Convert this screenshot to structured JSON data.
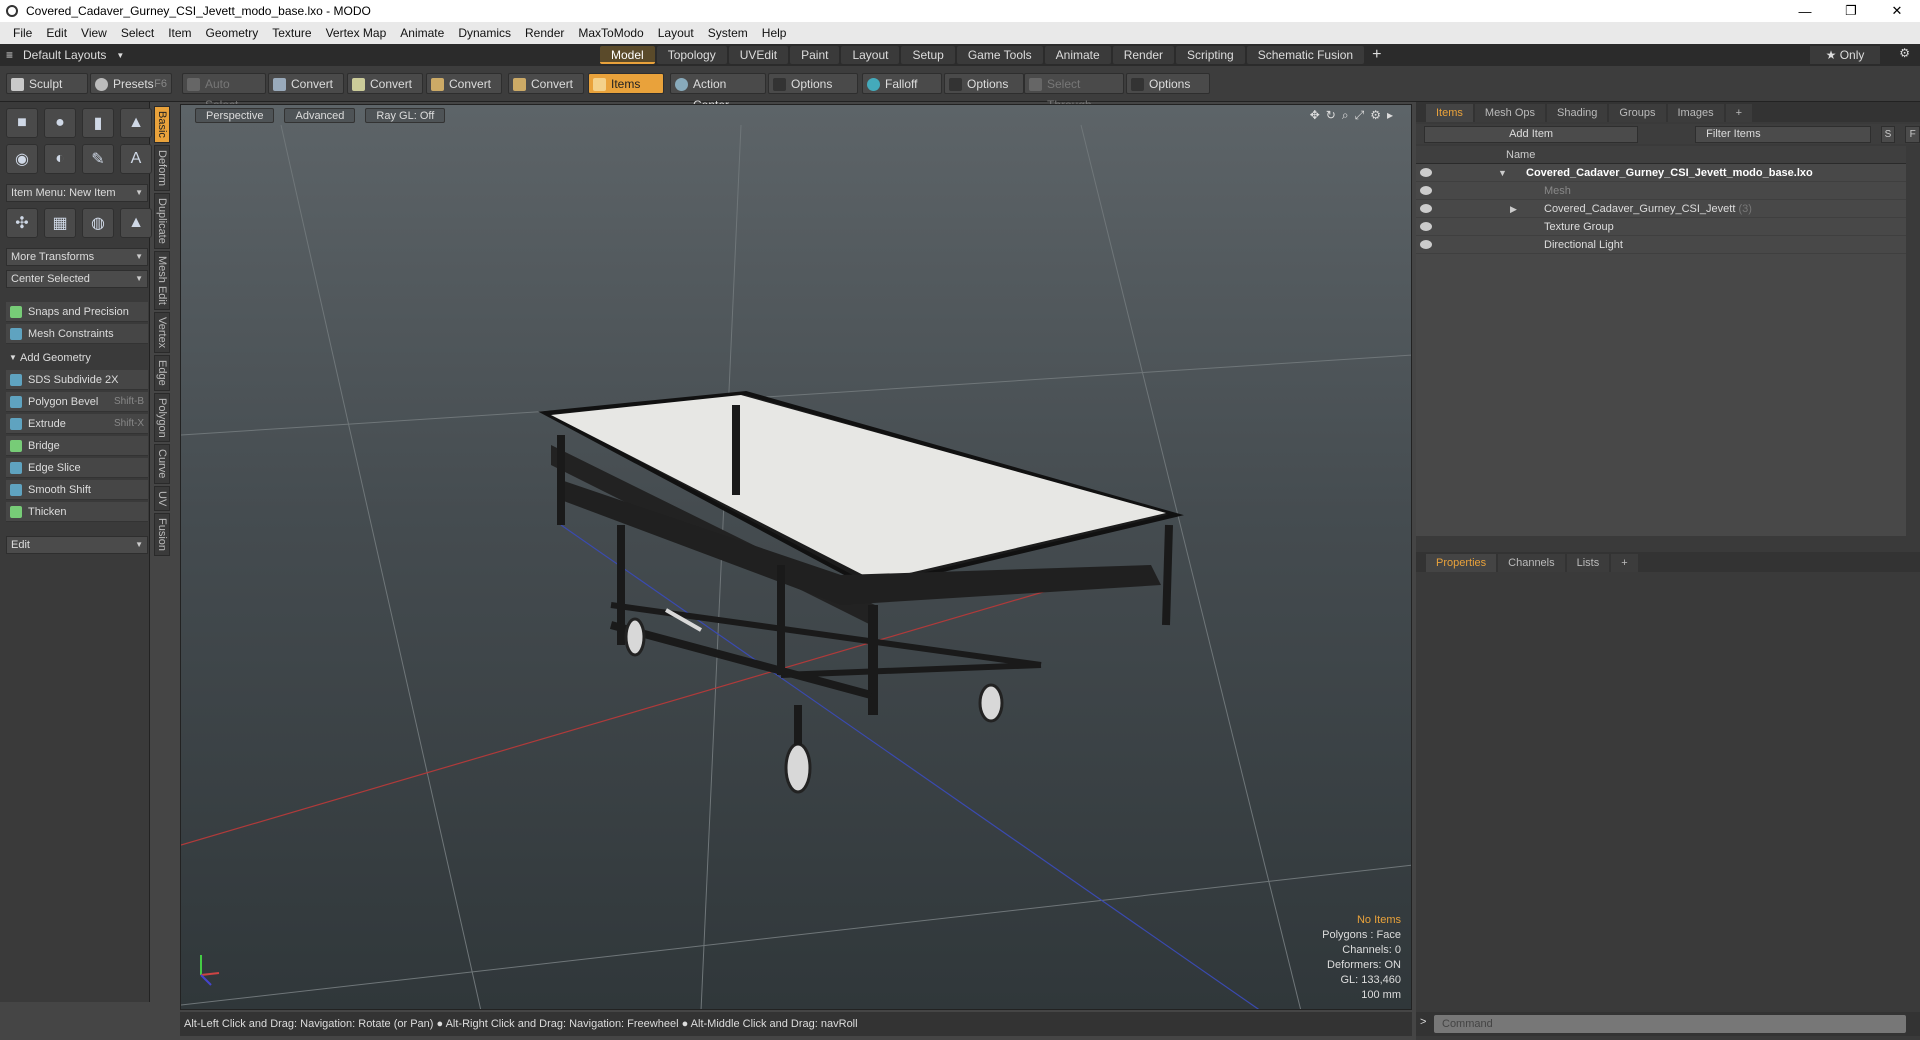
{
  "window": {
    "title": "Covered_Cadaver_Gurney_CSI_Jevett_modo_base.lxo - MODO",
    "minimize": "—",
    "restore": "❐",
    "close": "✕"
  },
  "menu": [
    "File",
    "Edit",
    "View",
    "Select",
    "Item",
    "Geometry",
    "Texture",
    "Vertex Map",
    "Animate",
    "Dynamics",
    "Render",
    "MaxToModo",
    "Layout",
    "System",
    "Help"
  ],
  "layoutbar": {
    "layouts": "Default Layouts",
    "tabs": [
      "Model",
      "Topology",
      "UVEdit",
      "Paint",
      "Layout",
      "Setup",
      "Game Tools",
      "Animate",
      "Render",
      "Scripting",
      "Schematic Fusion"
    ],
    "active_tab": "Model",
    "plus": "+",
    "only": "★ Only"
  },
  "toolbar": {
    "sculpt": "Sculpt",
    "presets": "Presets",
    "presets_key": "F6",
    "auto_select": "Auto Select",
    "convert1": "Convert",
    "convert2": "Convert",
    "convert3": "Convert",
    "convert4": "Convert",
    "items": "Items",
    "action_center": "Action Center",
    "options1": "Options",
    "falloff": "Falloff",
    "options2": "Options",
    "select_through": "Select Through",
    "options3": "Options"
  },
  "leftpanel": {
    "item_menu": "Item Menu: New Item",
    "more_transforms": "More Transforms",
    "center_selected": "Center Selected",
    "snaps": "Snaps and Precision",
    "mesh_constraints": "Mesh Constraints",
    "add_geometry": "Add Geometry",
    "tools": [
      {
        "label": "SDS Subdivide 2X",
        "key": ""
      },
      {
        "label": "Polygon Bevel",
        "key": "Shift-B"
      },
      {
        "label": "Extrude",
        "key": "Shift-X"
      },
      {
        "label": "Bridge",
        "key": ""
      },
      {
        "label": "Edge Slice",
        "key": ""
      },
      {
        "label": "Smooth Shift",
        "key": ""
      },
      {
        "label": "Thicken",
        "key": ""
      }
    ],
    "edit": "Edit",
    "sidetabs": [
      "Basic",
      "Deform",
      "Duplicate",
      "Mesh Edit",
      "Vertex",
      "Edge",
      "Polygon",
      "Curve",
      "UV",
      "Fusion"
    ]
  },
  "viewport": {
    "view": "Perspective",
    "shading": "Advanced",
    "raygl": "Ray GL: Off",
    "info": {
      "noitems": "No Items",
      "polygons": "Polygons : Face",
      "channels": "Channels: 0",
      "deformers": "Deformers: ON",
      "gl": "GL: 133,460",
      "units": "100 mm"
    }
  },
  "statusbar": "Alt-Left Click and Drag: Navigation: Rotate (or Pan) ● Alt-Right Click and Drag: Navigation: Freewheel ● Alt-Middle Click and Drag: navRoll",
  "items_panel": {
    "tabs": [
      "Items",
      "Mesh Ops",
      "Shading",
      "Groups",
      "Images",
      "+"
    ],
    "add_item": "Add Item",
    "filter": "Filter Items",
    "s": "S",
    "f": "F",
    "name_header": "Name",
    "rows": [
      {
        "label": "Covered_Cadaver_Gurney_CSI_Jevett_modo_base.lxo",
        "count": ""
      },
      {
        "label": "Mesh",
        "count": ""
      },
      {
        "label": "Covered_Cadaver_Gurney_CSI_Jevett",
        "count": "(3)"
      },
      {
        "label": "Texture Group",
        "count": ""
      },
      {
        "label": "Directional Light",
        "count": ""
      }
    ]
  },
  "props_panel": {
    "tabs": [
      "Properties",
      "Channels",
      "Lists",
      "+"
    ]
  },
  "command": {
    "placeholder": "Command",
    "prompt": ">"
  }
}
